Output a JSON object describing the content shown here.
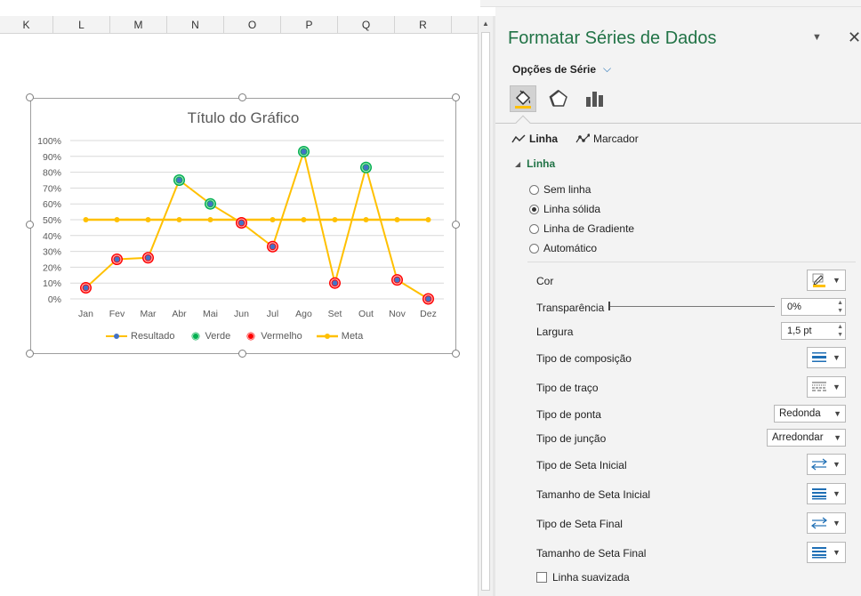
{
  "sheet": {
    "columns": [
      "K",
      "L",
      "M",
      "N",
      "O",
      "P",
      "Q",
      "R"
    ]
  },
  "chart_data": {
    "type": "line",
    "title": "Título do Gráfico",
    "categories": [
      "Jan",
      "Fev",
      "Mar",
      "Abr",
      "Mai",
      "Jun",
      "Jul",
      "Ago",
      "Set",
      "Out",
      "Nov",
      "Dez"
    ],
    "y_ticks": [
      "100%",
      "90%",
      "80%",
      "70%",
      "60%",
      "50%",
      "40%",
      "30%",
      "20%",
      "10%",
      "0%"
    ],
    "ylim": [
      0,
      1
    ],
    "grid": true,
    "legend_position": "bottom",
    "series": [
      {
        "name": "Resultado",
        "type": "line",
        "color": "#FFC000",
        "marker_color": "#4472C4",
        "values": [
          0.07,
          0.25,
          0.26,
          0.75,
          0.6,
          0.48,
          0.33,
          0.93,
          0.1,
          0.83,
          0.12,
          0.0
        ]
      },
      {
        "name": "Verde",
        "type": "marker",
        "color": "#00B050",
        "values": [
          null,
          null,
          null,
          0.75,
          0.6,
          null,
          null,
          0.93,
          null,
          0.83,
          null,
          null
        ]
      },
      {
        "name": "Vermelho",
        "type": "marker",
        "color": "#FF0000",
        "values": [
          0.07,
          0.25,
          0.26,
          null,
          null,
          0.48,
          0.33,
          null,
          0.1,
          null,
          0.12,
          0.0
        ]
      },
      {
        "name": "Meta",
        "type": "line",
        "color": "#FFC000",
        "marker_color": "#FFC000",
        "values": [
          0.5,
          0.5,
          0.5,
          0.5,
          0.5,
          0.5,
          0.5,
          0.5,
          0.5,
          0.5,
          0.5,
          0.5
        ]
      }
    ]
  },
  "pane": {
    "title": "Formatar Séries de Dados",
    "menu_glyph": "▼",
    "close_glyph": "✕",
    "series_options": "Opções de Série",
    "series_chevron": "⌵",
    "tabs": [
      "fill-line",
      "effects",
      "series-options"
    ],
    "subtabs": {
      "line": "Linha",
      "marker": "Marcador"
    },
    "section": "Linha",
    "line_options": [
      {
        "label": "Sem linha",
        "checked": false
      },
      {
        "label": "Linha sólida",
        "checked": true
      },
      {
        "label": "Linha de Gradiente",
        "checked": false
      },
      {
        "label": "Automático",
        "checked": false
      }
    ],
    "props": {
      "color_label": "Cor",
      "transparency_label": "Transparência",
      "transparency_value": "0%",
      "width_label": "Largura",
      "width_value": "1,5 pt",
      "compound_label": "Tipo de composição",
      "dash_label": "Tipo de traço",
      "cap_label": "Tipo de ponta",
      "cap_value": "Redonda",
      "join_label": "Tipo de junção",
      "join_value": "Arredondar",
      "begin_arrow_type_label": "Tipo de Seta Inicial",
      "begin_arrow_size_label": "Tamanho de Seta Inicial",
      "end_arrow_type_label": "Tipo de Seta Final",
      "end_arrow_size_label": "Tamanho de Seta Final",
      "smooth_label": "Linha suavizada",
      "smooth_checked": false
    },
    "accent_color": "#217346"
  }
}
